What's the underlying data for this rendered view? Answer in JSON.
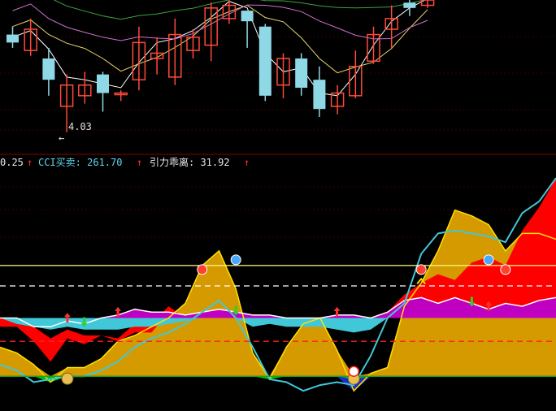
{
  "header": {
    "items": [
      {
        "text": "0.25",
        "color": "#e8e8e8"
      },
      {
        "text": "CCI买卖: 261.70",
        "color": "#5fd7f0"
      },
      {
        "text": "引力乖离: 31.92",
        "color": "#e8e8e8"
      }
    ],
    "up_arrow": "↑",
    "arrow_color": "#ff3030"
  },
  "price_annotation": {
    "text": "4.03",
    "pointer": "←"
  },
  "colors": {
    "up": "#ff4a3a",
    "down": "#8fd8e6",
    "ma_white": "#ffffff",
    "ma_yellow": "#e8d86a",
    "ma_magenta": "#d070d0",
    "ma_green": "#40a040",
    "gold": "#d49a00",
    "red": "#ff0000",
    "magenta": "#c000c0",
    "cyan": "#40c8d8",
    "green": "#00c000",
    "blue": "#1a2ad0",
    "separator": "#8a0000"
  },
  "chart_data": [
    {
      "type": "candlestick",
      "title": "",
      "price_low_label": 4.03,
      "candles": [
        {
          "o": 7.7,
          "c": 7.4,
          "h": 8.0,
          "l": 7.2
        },
        {
          "o": 7.1,
          "c": 7.9,
          "h": 8.3,
          "l": 6.9
        },
        {
          "o": 6.8,
          "c": 6.0,
          "h": 7.2,
          "l": 5.4
        },
        {
          "o": 5.0,
          "c": 5.8,
          "h": 6.2,
          "l": 4.03
        },
        {
          "o": 5.4,
          "c": 5.8,
          "h": 6.3,
          "l": 5.1
        },
        {
          "o": 6.2,
          "c": 5.5,
          "h": 6.3,
          "l": 4.8
        },
        {
          "o": 5.5,
          "c": 5.5,
          "h": 5.6,
          "l": 5.2
        },
        {
          "o": 6.0,
          "c": 7.4,
          "h": 8.0,
          "l": 5.6
        },
        {
          "o": 6.8,
          "c": 7.0,
          "h": 7.6,
          "l": 6.2
        },
        {
          "o": 6.1,
          "c": 7.7,
          "h": 8.3,
          "l": 5.8
        },
        {
          "o": 7.1,
          "c": 7.6,
          "h": 7.9,
          "l": 6.8
        },
        {
          "o": 7.3,
          "c": 8.7,
          "h": 8.9,
          "l": 6.7
        },
        {
          "o": 8.3,
          "c": 8.8,
          "h": 9.0,
          "l": 8.1
        },
        {
          "o": 8.6,
          "c": 8.2,
          "h": 8.6,
          "l": 7.2
        },
        {
          "o": 8.0,
          "c": 5.4,
          "h": 8.1,
          "l": 5.2
        },
        {
          "o": 5.8,
          "c": 6.8,
          "h": 7.0,
          "l": 5.3
        },
        {
          "o": 6.8,
          "c": 5.7,
          "h": 7.0,
          "l": 5.4
        },
        {
          "o": 6.0,
          "c": 4.9,
          "h": 6.5,
          "l": 4.6
        },
        {
          "o": 5.0,
          "c": 5.5,
          "h": 5.8,
          "l": 4.7
        },
        {
          "o": 5.4,
          "c": 6.5,
          "h": 7.1,
          "l": 5.3
        },
        {
          "o": 6.7,
          "c": 7.7,
          "h": 8.0,
          "l": 6.6
        },
        {
          "o": 7.9,
          "c": 8.3,
          "h": 8.8,
          "l": 7.2
        },
        {
          "o": 8.9,
          "c": 8.7,
          "h": 9.1,
          "l": 8.4
        },
        {
          "o": 8.8,
          "c": 9.0,
          "h": 9.2,
          "l": 8.7
        }
      ],
      "ylim": [
        3.5,
        9.0
      ]
    },
    {
      "type": "area",
      "title": "",
      "x": [
        0,
        1,
        2,
        3,
        4,
        5,
        6,
        7,
        8,
        9,
        10,
        11,
        12,
        13,
        14,
        15,
        16,
        17,
        18,
        19,
        20,
        21,
        22,
        23,
        24,
        25,
        26,
        27,
        28,
        29,
        30,
        31,
        32,
        33
      ],
      "ylim": [
        -8,
        70
      ],
      "baseline": 0,
      "reference_lines": [
        {
          "value": 38,
          "color": "#ffff80",
          "style": "solid"
        },
        {
          "value": 31,
          "color": "#ffffff",
          "style": "dashed"
        },
        {
          "value": 12,
          "color": "#ff2020",
          "style": "dashed"
        }
      ],
      "series": [
        {
          "role": "gold_area",
          "values": [
            10,
            8,
            4,
            -2,
            3,
            3,
            6,
            12,
            14,
            17,
            20,
            25,
            38,
            43,
            30,
            8,
            -1,
            10,
            18,
            20,
            9,
            -5,
            1,
            3,
            24,
            32,
            43,
            57,
            55,
            52,
            43,
            49,
            49,
            47
          ]
        },
        {
          "role": "red_area_top",
          "values": [
            20,
            20,
            17,
            13,
            16,
            14,
            14,
            13,
            18,
            18,
            24,
            20,
            20,
            22,
            21,
            16,
            20,
            20,
            20,
            20,
            19,
            20,
            20,
            22,
            28,
            32,
            35,
            33,
            39,
            41,
            38,
            50,
            58,
            68
          ]
        },
        {
          "role": "red_area_bottom",
          "values": [
            17,
            17,
            12,
            5,
            13,
            11,
            14,
            12,
            15,
            15,
            22,
            20,
            20,
            22,
            21,
            16,
            20,
            20,
            20,
            20,
            19,
            20,
            20,
            22,
            20,
            20,
            20,
            20,
            20,
            20,
            20,
            20,
            20,
            20
          ]
        },
        {
          "role": "magenta_top",
          "values": [
            20,
            20,
            17,
            17,
            19,
            18,
            20,
            21,
            23,
            22,
            22,
            21,
            22,
            23,
            22,
            21,
            21,
            20,
            20,
            20,
            21,
            21,
            20,
            22,
            26,
            27,
            25,
            27,
            25,
            23,
            25,
            24,
            26,
            27
          ]
        },
        {
          "role": "cyan_area_top",
          "values": [
            20,
            18,
            17,
            16,
            17,
            16,
            16,
            16,
            17,
            17,
            18,
            19,
            20,
            21,
            20,
            17,
            18,
            17,
            17,
            17,
            16,
            15,
            16,
            20,
            20,
            20,
            20,
            20,
            20,
            20,
            20,
            20,
            20,
            20
          ]
        },
        {
          "role": "cyan_line",
          "values": [
            4,
            2,
            -2,
            -1,
            0,
            0,
            2,
            5,
            10,
            13,
            15,
            18,
            22,
            26,
            20,
            10,
            -1,
            -2,
            -5,
            -3,
            -2,
            -3,
            7,
            20,
            25,
            42,
            49,
            50,
            49,
            48,
            46,
            56,
            60,
            68
          ]
        }
      ],
      "markers": [
        {
          "x": 4,
          "kind": "up-arrow"
        },
        {
          "x": 5,
          "kind": "down-arrow"
        },
        {
          "x": 7,
          "kind": "up-arrow"
        },
        {
          "x": 12,
          "kind": "ball-red"
        },
        {
          "x": 14,
          "kind": "ball-blue"
        },
        {
          "x": 14,
          "kind": "down-arrow"
        },
        {
          "x": 4,
          "kind": "smiley"
        },
        {
          "x": 21,
          "kind": "smiley"
        },
        {
          "x": 21,
          "kind": "plus-ball"
        },
        {
          "x": 20,
          "kind": "up-arrow"
        },
        {
          "x": 25,
          "kind": "chevron-up"
        },
        {
          "x": 25,
          "kind": "ball-red"
        },
        {
          "x": 28,
          "kind": "down-arrow"
        },
        {
          "x": 29,
          "kind": "up-arrow"
        },
        {
          "x": 29,
          "kind": "ball-blue"
        },
        {
          "x": 30,
          "kind": "ball-red"
        }
      ]
    }
  ]
}
